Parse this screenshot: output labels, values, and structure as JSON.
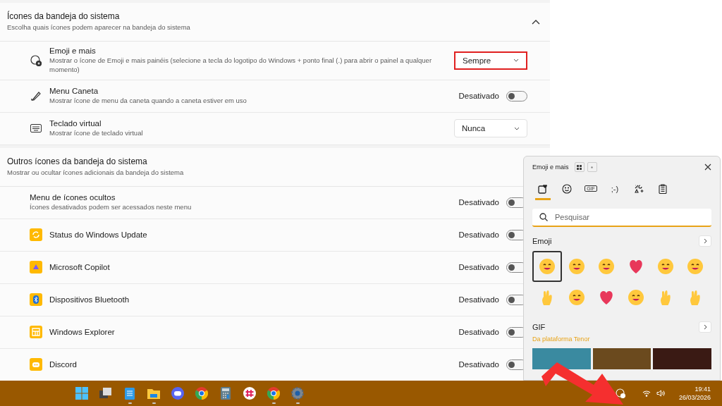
{
  "sections": [
    {
      "title": "Ícones da bandeja do sistema",
      "subtitle": "Escolha quais ícones podem aparecer na bandeja do sistema",
      "expanded": true,
      "rows": [
        {
          "kind": "select",
          "title": "Emoji e mais",
          "description": "Mostrar o ícone de Emoji e mais painéis (selecione a tecla do logotipo do Windows + ponto final (.) para abrir o painel a qualquer momento)",
          "value": "Sempre",
          "highlighted": true
        },
        {
          "kind": "toggle",
          "title": "Menu Caneta",
          "description": "Mostrar ícone de menu da caneta quando a caneta estiver em uso",
          "status": "Desativado",
          "on": false
        },
        {
          "kind": "select",
          "title": "Teclado virtual",
          "description": "Mostrar ícone de teclado virtual",
          "value": "Nunca",
          "highlighted": false
        }
      ]
    },
    {
      "title": "Outros ícones da bandeja do sistema",
      "subtitle": "Mostrar ou ocultar ícones adicionais da bandeja do sistema",
      "rows": [
        {
          "kind": "toggle",
          "title": "Menu de ícones ocultos",
          "description": "Ícones desativados podem ser acessados neste menu",
          "status": "Desativado",
          "on": false
        },
        {
          "kind": "toggle",
          "title": "Status do Windows Update",
          "status": "Desativado",
          "on": false
        },
        {
          "kind": "toggle",
          "title": "Microsoft Copilot",
          "status": "Desativado",
          "on": false
        },
        {
          "kind": "toggle",
          "title": "Dispositivos Bluetooth",
          "status": "Desativado",
          "on": false
        },
        {
          "kind": "toggle",
          "title": "Windows Explorer",
          "status": "Desativado",
          "on": false
        },
        {
          "kind": "toggle",
          "title": "Discord",
          "status": "Desativado",
          "on": false
        }
      ]
    }
  ],
  "emoji_panel": {
    "title": "Emoji e mais",
    "tabs": [
      {
        "kind": "recent",
        "selected": true
      },
      {
        "kind": "smiley",
        "selected": false
      },
      {
        "kind": "gif",
        "label": "GIF",
        "selected": false
      },
      {
        "kind": "kaomoji",
        "label": ";-)",
        "selected": false
      },
      {
        "kind": "symbols",
        "selected": false
      },
      {
        "kind": "clipboard",
        "selected": false
      }
    ],
    "search": {
      "placeholder": "Pesquisar"
    },
    "emoji_heading": "Emoji",
    "emojis": [
      {
        "kind": "face",
        "selected": true
      },
      {
        "kind": "face",
        "selected": false
      },
      {
        "kind": "face",
        "selected": false
      },
      {
        "kind": "heart",
        "selected": false
      },
      {
        "kind": "face",
        "selected": false
      },
      {
        "kind": "face",
        "selected": false
      },
      {
        "kind": "hand",
        "selected": false
      },
      {
        "kind": "face",
        "selected": false
      },
      {
        "kind": "heart",
        "selected": false
      },
      {
        "kind": "face",
        "selected": false
      },
      {
        "kind": "hand",
        "selected": false
      },
      {
        "kind": "hand",
        "selected": false
      }
    ],
    "gif_heading": "GIF",
    "gif_source": "Da plataforma Tenor"
  },
  "taskbar": {
    "apps": [
      {
        "kind": "start",
        "running": false
      },
      {
        "kind": "windows",
        "running": false
      },
      {
        "kind": "notepad",
        "running": true
      },
      {
        "kind": "folder",
        "running": true
      },
      {
        "kind": "chat",
        "running": false
      },
      {
        "kind": "browser",
        "running": false
      },
      {
        "kind": "calculator",
        "running": false
      },
      {
        "kind": "hub",
        "running": false
      },
      {
        "kind": "browser",
        "running": true
      },
      {
        "kind": "gear",
        "running": true
      }
    ],
    "time": "19:41",
    "date": "26/03/2026"
  }
}
